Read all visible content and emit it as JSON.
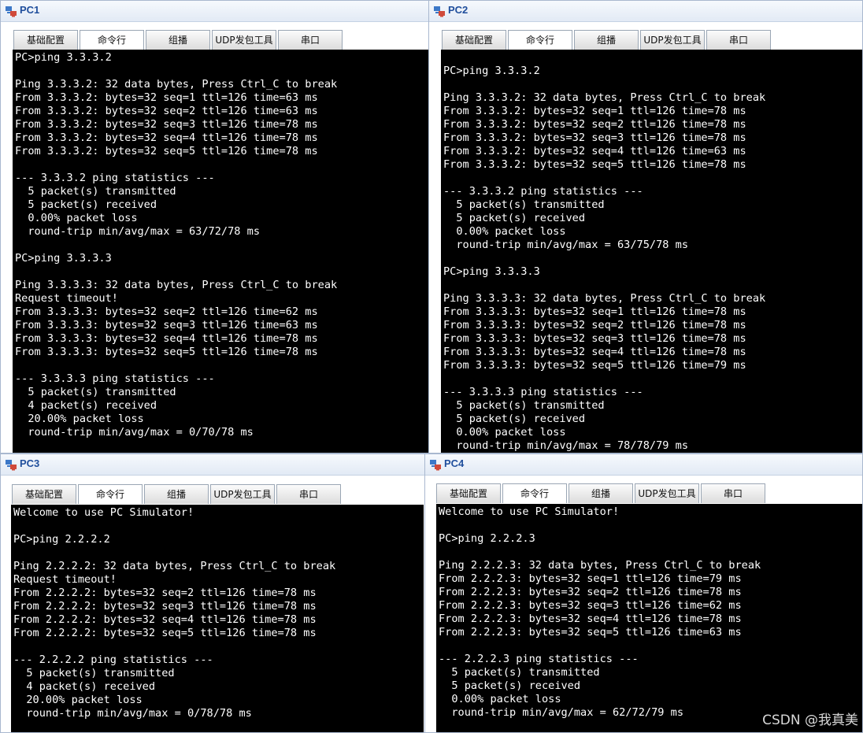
{
  "tab_labels": [
    "基础配置",
    "命令行",
    "组播",
    "UDP发包工具",
    "串口"
  ],
  "colors": {
    "terminal_bg": "#000000",
    "terminal_fg": "#ffffff",
    "title_text": "#1f4e9c"
  },
  "icon": "pc-simulator-icon",
  "windows": [
    {
      "title": "PC1",
      "active_tab": "命令行",
      "terminal": "PC>ping 3.3.3.2\n\nPing 3.3.3.2: 32 data bytes, Press Ctrl_C to break\nFrom 3.3.3.2: bytes=32 seq=1 ttl=126 time=63 ms\nFrom 3.3.3.2: bytes=32 seq=2 ttl=126 time=63 ms\nFrom 3.3.3.2: bytes=32 seq=3 ttl=126 time=78 ms\nFrom 3.3.3.2: bytes=32 seq=4 ttl=126 time=78 ms\nFrom 3.3.3.2: bytes=32 seq=5 ttl=126 time=78 ms\n\n--- 3.3.3.2 ping statistics ---\n  5 packet(s) transmitted\n  5 packet(s) received\n  0.00% packet loss\n  round-trip min/avg/max = 63/72/78 ms\n\nPC>ping 3.3.3.3\n\nPing 3.3.3.3: 32 data bytes, Press Ctrl_C to break\nRequest timeout!\nFrom 3.3.3.3: bytes=32 seq=2 ttl=126 time=62 ms\nFrom 3.3.3.3: bytes=32 seq=3 ttl=126 time=63 ms\nFrom 3.3.3.3: bytes=32 seq=4 ttl=126 time=78 ms\nFrom 3.3.3.3: bytes=32 seq=5 ttl=126 time=78 ms\n\n--- 3.3.3.3 ping statistics ---\n  5 packet(s) transmitted\n  4 packet(s) received\n  20.00% packet loss\n  round-trip min/avg/max = 0/70/78 ms"
    },
    {
      "title": "PC2",
      "active_tab": "命令行",
      "terminal": "\nPC>ping 3.3.3.2\n\nPing 3.3.3.2: 32 data bytes, Press Ctrl_C to break\nFrom 3.3.3.2: bytes=32 seq=1 ttl=126 time=78 ms\nFrom 3.3.3.2: bytes=32 seq=2 ttl=126 time=78 ms\nFrom 3.3.3.2: bytes=32 seq=3 ttl=126 time=78 ms\nFrom 3.3.3.2: bytes=32 seq=4 ttl=126 time=63 ms\nFrom 3.3.3.2: bytes=32 seq=5 ttl=126 time=78 ms\n\n--- 3.3.3.2 ping statistics ---\n  5 packet(s) transmitted\n  5 packet(s) received\n  0.00% packet loss\n  round-trip min/avg/max = 63/75/78 ms\n\nPC>ping 3.3.3.3\n\nPing 3.3.3.3: 32 data bytes, Press Ctrl_C to break\nFrom 3.3.3.3: bytes=32 seq=1 ttl=126 time=78 ms\nFrom 3.3.3.3: bytes=32 seq=2 ttl=126 time=78 ms\nFrom 3.3.3.3: bytes=32 seq=3 ttl=126 time=78 ms\nFrom 3.3.3.3: bytes=32 seq=4 ttl=126 time=78 ms\nFrom 3.3.3.3: bytes=32 seq=5 ttl=126 time=79 ms\n\n--- 3.3.3.3 ping statistics ---\n  5 packet(s) transmitted\n  5 packet(s) received\n  0.00% packet loss\n  round-trip min/avg/max = 78/78/79 ms"
    },
    {
      "title": "PC3",
      "active_tab": "命令行",
      "terminal": "Welcome to use PC Simulator!\n\nPC>ping 2.2.2.2\n\nPing 2.2.2.2: 32 data bytes, Press Ctrl_C to break\nRequest timeout!\nFrom 2.2.2.2: bytes=32 seq=2 ttl=126 time=78 ms\nFrom 2.2.2.2: bytes=32 seq=3 ttl=126 time=78 ms\nFrom 2.2.2.2: bytes=32 seq=4 ttl=126 time=78 ms\nFrom 2.2.2.2: bytes=32 seq=5 ttl=126 time=78 ms\n\n--- 2.2.2.2 ping statistics ---\n  5 packet(s) transmitted\n  4 packet(s) received\n  20.00% packet loss\n  round-trip min/avg/max = 0/78/78 ms"
    },
    {
      "title": "PC4",
      "active_tab": "命令行",
      "terminal": "Welcome to use PC Simulator!\n\nPC>ping 2.2.2.3\n\nPing 2.2.2.3: 32 data bytes, Press Ctrl_C to break\nFrom 2.2.2.3: bytes=32 seq=1 ttl=126 time=79 ms\nFrom 2.2.2.3: bytes=32 seq=2 ttl=126 time=78 ms\nFrom 2.2.2.3: bytes=32 seq=3 ttl=126 time=62 ms\nFrom 2.2.2.3: bytes=32 seq=4 ttl=126 time=78 ms\nFrom 2.2.2.3: bytes=32 seq=5 ttl=126 time=63 ms\n\n--- 2.2.2.3 ping statistics ---\n  5 packet(s) transmitted\n  5 packet(s) received\n  0.00% packet loss\n  round-trip min/avg/max = 62/72/79 ms"
    }
  ],
  "watermark": "CSDN @我真美"
}
